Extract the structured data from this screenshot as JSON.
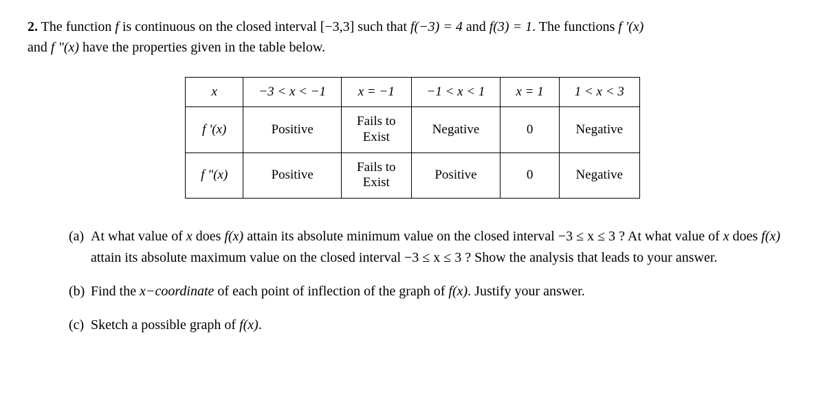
{
  "problem": {
    "number": "2.",
    "intro_part1": "The function ",
    "intro_f": "f",
    "intro_part2": " is continuous on the closed interval ",
    "interval": "[−3,3]",
    "intro_part3": " such that ",
    "fneg3": "f(−3) = 4",
    "intro_part4": " and ",
    "f3": "f(3) = 1",
    "intro_part5": ". The functions ",
    "fprime": "f '(x)",
    "intro_part6": " and ",
    "fdprime": "f \"(x)",
    "intro_part7": " have the properties given in the table below."
  },
  "table": {
    "header": {
      "c0": "x",
      "c1": "−3 < x < −1",
      "c2": "x = −1",
      "c3": "−1 < x < 1",
      "c4": "x = 1",
      "c5": "1 < x < 3"
    },
    "row1": {
      "label": "f '(x)",
      "c1": "Positive",
      "c2a": "Fails to",
      "c2b": "Exist",
      "c3": "Negative",
      "c4": "0",
      "c5": "Negative"
    },
    "row2": {
      "label": "f \"(x)",
      "c1": "Positive",
      "c2a": "Fails to",
      "c2b": "Exist",
      "c3": "Positive",
      "c4": "0",
      "c5": "Negative"
    }
  },
  "parts": {
    "a": {
      "label": "(a)",
      "t1": "At what value of ",
      "x1": "x",
      "t2": " does ",
      "fx1": "f(x)",
      "t3": " attain its absolute minimum value on the closed interval ",
      "int1": "−3 ≤ x ≤ 3 ?",
      "t4": " At what value of ",
      "x2": "x",
      "t5": " does ",
      "fx2": "f(x)",
      "t6": " attain its absolute maximum value on the closed interval ",
      "int2": "−3 ≤ x ≤ 3 ?",
      "t7": " Show the analysis that leads to your answer."
    },
    "b": {
      "label": "(b)",
      "t1": "Find the ",
      "xc": "x−coordinate",
      "t2": " of each point of inflection of the graph of ",
      "fx": "f(x)",
      "t3": ". Justify your answer."
    },
    "c": {
      "label": "(c)",
      "t1": "Sketch a possible graph of ",
      "fx": "f(x)",
      "t2": "."
    }
  },
  "chart_data": {
    "type": "table",
    "columns": [
      "x",
      "-3 < x < -1",
      "x = -1",
      "-1 < x < 1",
      "x = 1",
      "1 < x < 3"
    ],
    "rows": [
      {
        "label": "f '(x)",
        "values": [
          "Positive",
          "Fails to Exist",
          "Negative",
          "0",
          "Negative"
        ]
      },
      {
        "label": "f \"(x)",
        "values": [
          "Positive",
          "Fails to Exist",
          "Positive",
          "0",
          "Negative"
        ]
      }
    ],
    "given": {
      "f(-3)": 4,
      "f(3)": 1
    },
    "interval": [
      -3,
      3
    ]
  }
}
